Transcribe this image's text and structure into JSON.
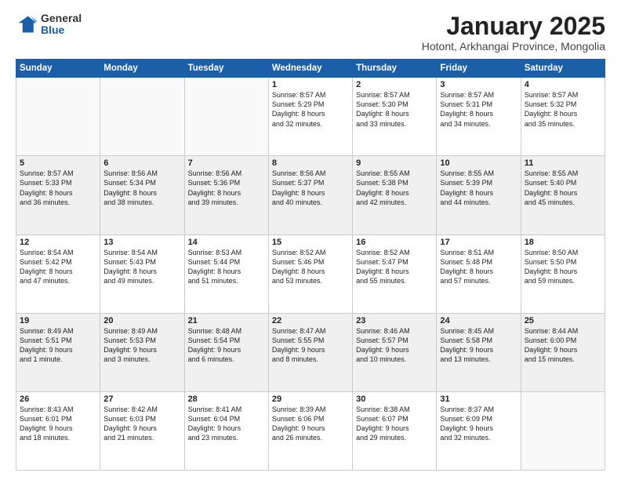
{
  "logo": {
    "general": "General",
    "blue": "Blue"
  },
  "title": "January 2025",
  "subtitle": "Hotont, Arkhangai Province, Mongolia",
  "weekdays": [
    "Sunday",
    "Monday",
    "Tuesday",
    "Wednesday",
    "Thursday",
    "Friday",
    "Saturday"
  ],
  "weeks": [
    [
      {
        "day": "",
        "info": ""
      },
      {
        "day": "",
        "info": ""
      },
      {
        "day": "",
        "info": ""
      },
      {
        "day": "1",
        "info": "Sunrise: 8:57 AM\nSunset: 5:29 PM\nDaylight: 8 hours\nand 32 minutes."
      },
      {
        "day": "2",
        "info": "Sunrise: 8:57 AM\nSunset: 5:30 PM\nDaylight: 8 hours\nand 33 minutes."
      },
      {
        "day": "3",
        "info": "Sunrise: 8:57 AM\nSunset: 5:31 PM\nDaylight: 8 hours\nand 34 minutes."
      },
      {
        "day": "4",
        "info": "Sunrise: 8:57 AM\nSunset: 5:32 PM\nDaylight: 8 hours\nand 35 minutes."
      }
    ],
    [
      {
        "day": "5",
        "info": "Sunrise: 8:57 AM\nSunset: 5:33 PM\nDaylight: 8 hours\nand 36 minutes."
      },
      {
        "day": "6",
        "info": "Sunrise: 8:56 AM\nSunset: 5:34 PM\nDaylight: 8 hours\nand 38 minutes."
      },
      {
        "day": "7",
        "info": "Sunrise: 8:56 AM\nSunset: 5:36 PM\nDaylight: 8 hours\nand 39 minutes."
      },
      {
        "day": "8",
        "info": "Sunrise: 8:56 AM\nSunset: 5:37 PM\nDaylight: 8 hours\nand 40 minutes."
      },
      {
        "day": "9",
        "info": "Sunrise: 8:55 AM\nSunset: 5:38 PM\nDaylight: 8 hours\nand 42 minutes."
      },
      {
        "day": "10",
        "info": "Sunrise: 8:55 AM\nSunset: 5:39 PM\nDaylight: 8 hours\nand 44 minutes."
      },
      {
        "day": "11",
        "info": "Sunrise: 8:55 AM\nSunset: 5:40 PM\nDaylight: 8 hours\nand 45 minutes."
      }
    ],
    [
      {
        "day": "12",
        "info": "Sunrise: 8:54 AM\nSunset: 5:42 PM\nDaylight: 8 hours\nand 47 minutes."
      },
      {
        "day": "13",
        "info": "Sunrise: 8:54 AM\nSunset: 5:43 PM\nDaylight: 8 hours\nand 49 minutes."
      },
      {
        "day": "14",
        "info": "Sunrise: 8:53 AM\nSunset: 5:44 PM\nDaylight: 8 hours\nand 51 minutes."
      },
      {
        "day": "15",
        "info": "Sunrise: 8:52 AM\nSunset: 5:46 PM\nDaylight: 8 hours\nand 53 minutes."
      },
      {
        "day": "16",
        "info": "Sunrise: 8:52 AM\nSunset: 5:47 PM\nDaylight: 8 hours\nand 55 minutes."
      },
      {
        "day": "17",
        "info": "Sunrise: 8:51 AM\nSunset: 5:48 PM\nDaylight: 8 hours\nand 57 minutes."
      },
      {
        "day": "18",
        "info": "Sunrise: 8:50 AM\nSunset: 5:50 PM\nDaylight: 8 hours\nand 59 minutes."
      }
    ],
    [
      {
        "day": "19",
        "info": "Sunrise: 8:49 AM\nSunset: 5:51 PM\nDaylight: 9 hours\nand 1 minute."
      },
      {
        "day": "20",
        "info": "Sunrise: 8:49 AM\nSunset: 5:53 PM\nDaylight: 9 hours\nand 3 minutes."
      },
      {
        "day": "21",
        "info": "Sunrise: 8:48 AM\nSunset: 5:54 PM\nDaylight: 9 hours\nand 6 minutes."
      },
      {
        "day": "22",
        "info": "Sunrise: 8:47 AM\nSunset: 5:55 PM\nDaylight: 9 hours\nand 8 minutes."
      },
      {
        "day": "23",
        "info": "Sunrise: 8:46 AM\nSunset: 5:57 PM\nDaylight: 9 hours\nand 10 minutes."
      },
      {
        "day": "24",
        "info": "Sunrise: 8:45 AM\nSunset: 5:58 PM\nDaylight: 9 hours\nand 13 minutes."
      },
      {
        "day": "25",
        "info": "Sunrise: 8:44 AM\nSunset: 6:00 PM\nDaylight: 9 hours\nand 15 minutes."
      }
    ],
    [
      {
        "day": "26",
        "info": "Sunrise: 8:43 AM\nSunset: 6:01 PM\nDaylight: 9 hours\nand 18 minutes."
      },
      {
        "day": "27",
        "info": "Sunrise: 8:42 AM\nSunset: 6:03 PM\nDaylight: 9 hours\nand 21 minutes."
      },
      {
        "day": "28",
        "info": "Sunrise: 8:41 AM\nSunset: 6:04 PM\nDaylight: 9 hours\nand 23 minutes."
      },
      {
        "day": "29",
        "info": "Sunrise: 8:39 AM\nSunset: 6:06 PM\nDaylight: 9 hours\nand 26 minutes."
      },
      {
        "day": "30",
        "info": "Sunrise: 8:38 AM\nSunset: 6:07 PM\nDaylight: 9 hours\nand 29 minutes."
      },
      {
        "day": "31",
        "info": "Sunrise: 8:37 AM\nSunset: 6:09 PM\nDaylight: 9 hours\nand 32 minutes."
      },
      {
        "day": "",
        "info": ""
      }
    ]
  ],
  "shaded_weeks": [
    1,
    3
  ],
  "empty_start": [
    0,
    1,
    2
  ],
  "empty_end": [
    6
  ]
}
